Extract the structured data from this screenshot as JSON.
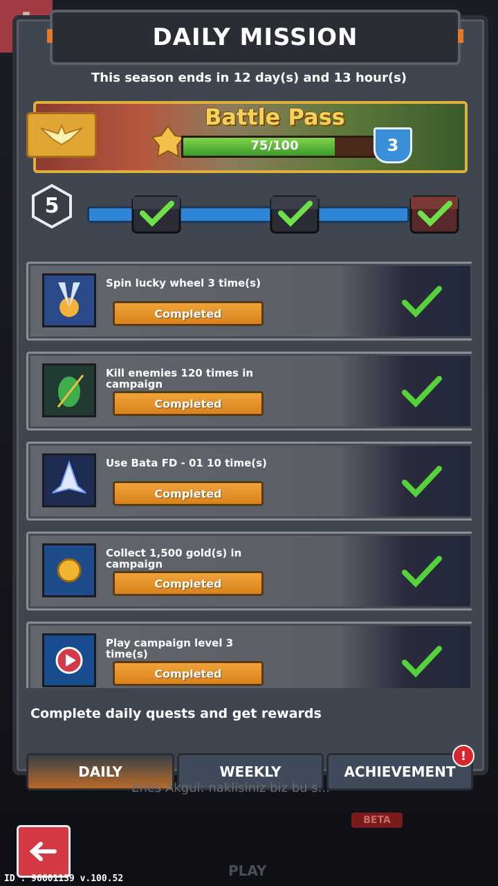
{
  "header": {
    "title": "DAILY MISSION",
    "season_text": "This season ends in 12 day(s) and 13 hour(s)"
  },
  "battle_pass": {
    "title": "Battle Pass",
    "progress_text": "75/100",
    "progress_fraction": 0.75,
    "level": "3"
  },
  "milestones": {
    "current_level": "5",
    "chests": [
      {
        "state": "claimed",
        "icon": "chest-check-icon"
      },
      {
        "state": "claimed",
        "icon": "chest-check-icon"
      },
      {
        "state": "claimed",
        "icon": "chest-check-icon"
      }
    ]
  },
  "missions": [
    {
      "text": "Spin lucky wheel 3 time(s)",
      "status": "Completed",
      "icon": "lucky-wheel-icon"
    },
    {
      "text": "Kill enemies 120 times in campaign",
      "status": "Completed",
      "icon": "enemy-kill-icon"
    },
    {
      "text": "Use Bata FD - 01 10 time(s)",
      "status": "Completed",
      "icon": "spaceship-icon"
    },
    {
      "text": "Collect 1,500 gold(s) in campaign",
      "status": "Completed",
      "icon": "gold-coin-icon"
    },
    {
      "text": "Play campaign level 3 time(s)",
      "status": "Completed",
      "icon": "play-campaign-icon"
    }
  ],
  "footer_hint": "Complete daily quests and get rewards",
  "tabs": [
    {
      "label": "DAILY",
      "active": true
    },
    {
      "label": "WEEKLY",
      "active": false
    },
    {
      "label": "ACHIEVEMENT",
      "active": false,
      "badge": "!"
    }
  ],
  "background": {
    "chat_text": "Enes Akgul: naklisiniz biz bu s...",
    "play_label": "PLAY",
    "beta_label": "BETA",
    "id_text": "ID : 96601139 v.100.52"
  },
  "colors": {
    "accent_orange": "#e08a2a",
    "progress_green": "#5fbf3a",
    "track_blue": "#2f86d6",
    "back_red": "#d33a44"
  }
}
